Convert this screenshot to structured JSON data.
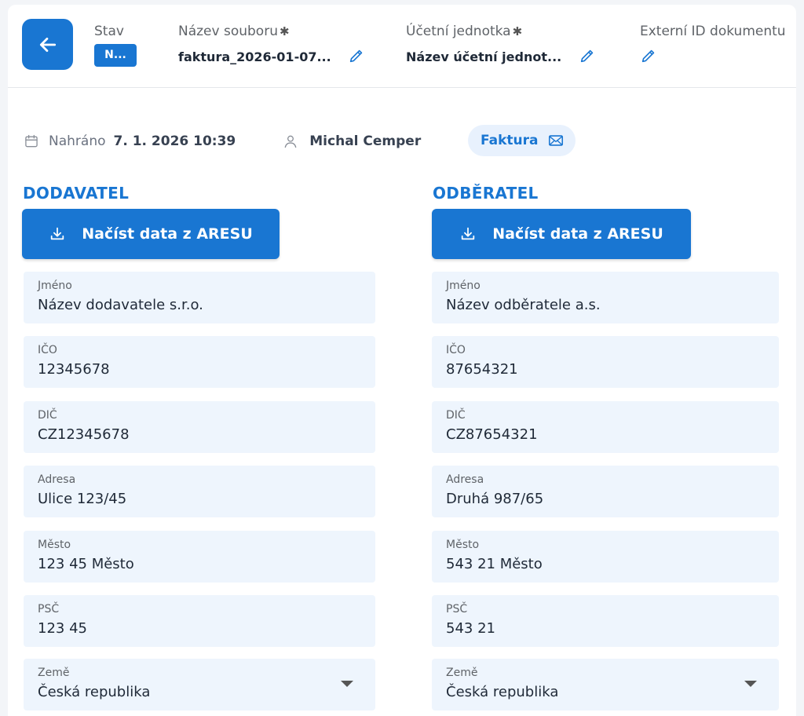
{
  "header": {
    "back_icon": "arrow-left-icon",
    "status": {
      "label": "Stav",
      "value": "N..."
    },
    "filename": {
      "label": "Název souboru",
      "required_mark": "✱",
      "value": "faktura_2026-01-07..."
    },
    "accounting_unit": {
      "label": "Účetní jednotka",
      "required_mark": "✱",
      "value": "Název účetní jednot..."
    },
    "external_id": {
      "label": "Externí ID dokumentu"
    }
  },
  "meta": {
    "uploaded_label": "Nahráno",
    "uploaded_value": "7. 1. 2026 10:39",
    "user": "Michal Cemper",
    "doc_type": "Faktura"
  },
  "supplier": {
    "title": "DODAVATEL",
    "ares_button": "Načíst data z ARESU",
    "fields": [
      {
        "label": "Jméno",
        "value": "Název dodavatele s.r.o."
      },
      {
        "label": "IČO",
        "value": "12345678"
      },
      {
        "label": "DIČ",
        "value": "CZ12345678"
      },
      {
        "label": "Adresa",
        "value": "Ulice 123/45"
      },
      {
        "label": "Město",
        "value": "123 45 Město"
      },
      {
        "label": "PSČ",
        "value": "123 45"
      },
      {
        "label": "Země",
        "value": "Česká republika"
      }
    ]
  },
  "customer": {
    "title": "ODBĚRATEL",
    "ares_button": "Načíst data z ARESU",
    "fields": [
      {
        "label": "Jméno",
        "value": "Název odběratele a.s."
      },
      {
        "label": "IČO",
        "value": "87654321"
      },
      {
        "label": "DIČ",
        "value": "CZ87654321"
      },
      {
        "label": "Adresa",
        "value": "Druhá 987/65"
      },
      {
        "label": "Město",
        "value": "543 21 Město"
      },
      {
        "label": "PSČ",
        "value": "543 21"
      },
      {
        "label": "Země",
        "value": "Česká republika"
      }
    ]
  },
  "colors": {
    "accent": "#1976d2",
    "field_bg": "#eef5fd",
    "chip_bg": "#e8f1fd"
  }
}
